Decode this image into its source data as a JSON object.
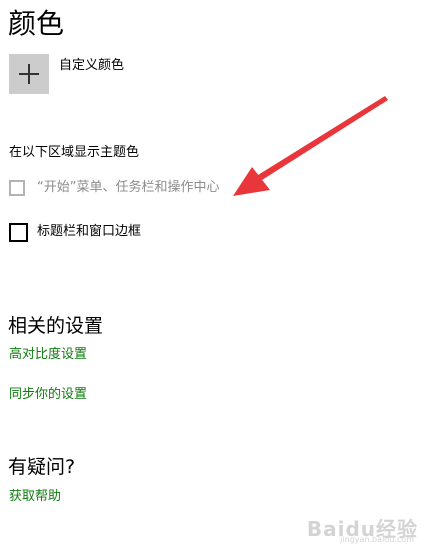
{
  "page": {
    "title": "颜色"
  },
  "custom_color": {
    "label": "自定义颜色",
    "icon": "plus-icon"
  },
  "accent_section": {
    "label": "在以下区域显示主题色",
    "options": [
      {
        "label": "“开始”菜单、任务栏和操作中心",
        "checked": false,
        "enabled": false
      },
      {
        "label": "标题栏和窗口边框",
        "checked": false,
        "enabled": true
      }
    ]
  },
  "related": {
    "heading": "相关的设置",
    "links": [
      "高对比度设置",
      "同步你的设置"
    ]
  },
  "question": {
    "heading": "有疑问?",
    "link": "获取帮助"
  },
  "watermark": {
    "text": "Baidu经验",
    "sub": "jingyan.baidu.com"
  },
  "colors": {
    "link": "#107c10",
    "arrow": "#e8363b",
    "button_bg": "#cccccc",
    "disabled_text": "#8c8c8c"
  }
}
